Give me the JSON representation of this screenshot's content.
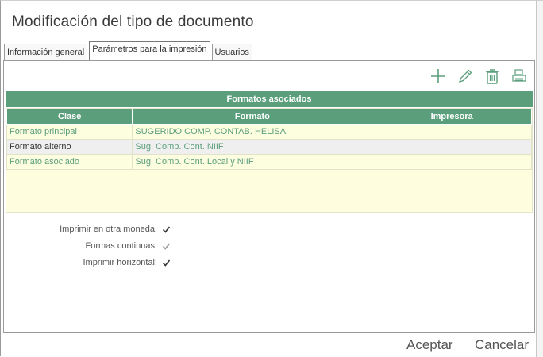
{
  "dialog": {
    "title": "Modificación del tipo de documento"
  },
  "tabs": [
    {
      "label": "Información general",
      "active": false
    },
    {
      "label": "Parámetros para la impresión",
      "active": true
    },
    {
      "label": "Usuarios",
      "active": false
    }
  ],
  "toolbar": {
    "icons": [
      "add-icon",
      "edit-pencil-icon",
      "delete-trash-icon",
      "print-icon"
    ],
    "accent_color": "#5a9e7b"
  },
  "grid": {
    "title": "Formatos asociados",
    "columns": [
      "Clase",
      "Formato",
      "Impresora"
    ],
    "rows": [
      {
        "clase": "Formato principal",
        "formato": "SUGERIDO COMP. CONTAB. HELISA",
        "impresora": ""
      },
      {
        "clase": "Formato alterno",
        "formato": "Sug. Comp. Cont. NIIF",
        "impresora": ""
      },
      {
        "clase": "Formato asociado",
        "formato": "Sug. Comp. Cont. Local y NIIF",
        "impresora": ""
      }
    ]
  },
  "options": {
    "otra_moneda": {
      "label": "Imprimir en otra moneda:",
      "checked": true
    },
    "formas_continuas": {
      "label": "Formas continuas:",
      "checked": true,
      "disabled": true
    },
    "horizontal": {
      "label": "Imprimir horizontal:",
      "checked": true
    }
  },
  "footer": {
    "accept_label": "Aceptar",
    "cancel_label": "Cancelar"
  }
}
